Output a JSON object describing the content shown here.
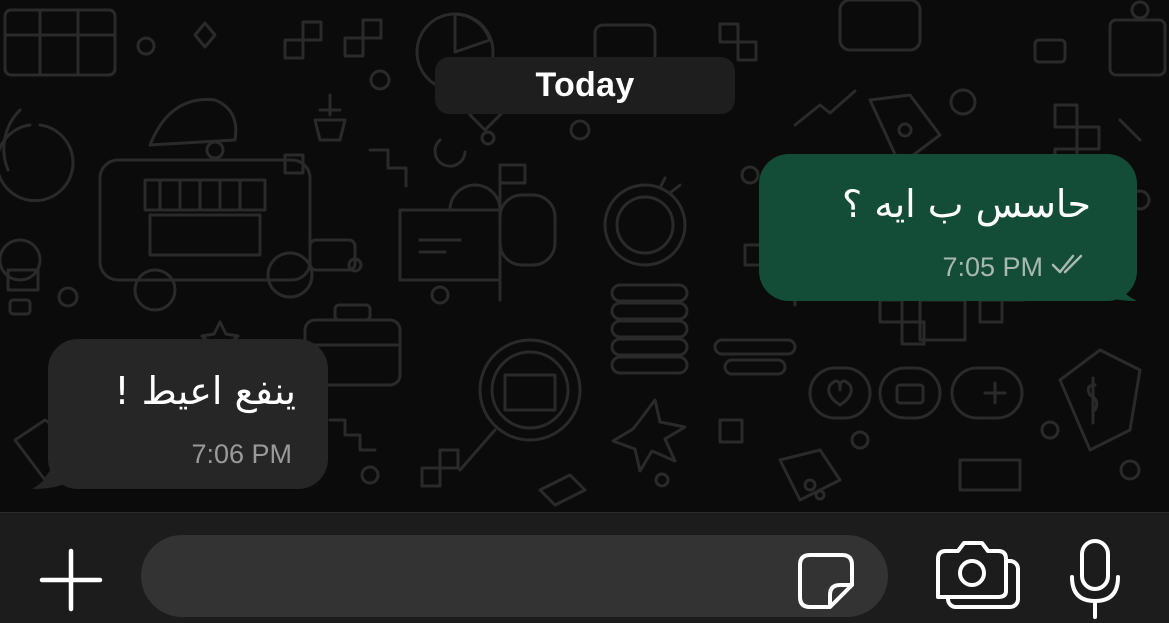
{
  "chat": {
    "date_divider": "Today",
    "messages": [
      {
        "direction": "outgoing",
        "text": "حاسس ب ايه ؟",
        "time": "7:05 PM",
        "status": "read",
        "status_icon": "double-check-icon"
      },
      {
        "direction": "incoming",
        "text": "ينفع اعيط !",
        "time": "7:06 PM"
      }
    ]
  },
  "composer": {
    "message_value": "",
    "message_placeholder": "",
    "attach_icon": "plus-icon",
    "sticker_icon": "sticker-icon",
    "camera_icon": "camera-icon",
    "mic_icon": "microphone-icon"
  },
  "colors": {
    "background": "#0b0b0b",
    "outgoing_bubble": "#144d37",
    "incoming_bubble": "#262626",
    "date_pill": "#1e1e1e",
    "composer_bar": "#1c1c1c",
    "input_field": "#333333",
    "meta_text_outgoing": "#a9b8b0",
    "meta_text_incoming": "#9a9a9a"
  }
}
